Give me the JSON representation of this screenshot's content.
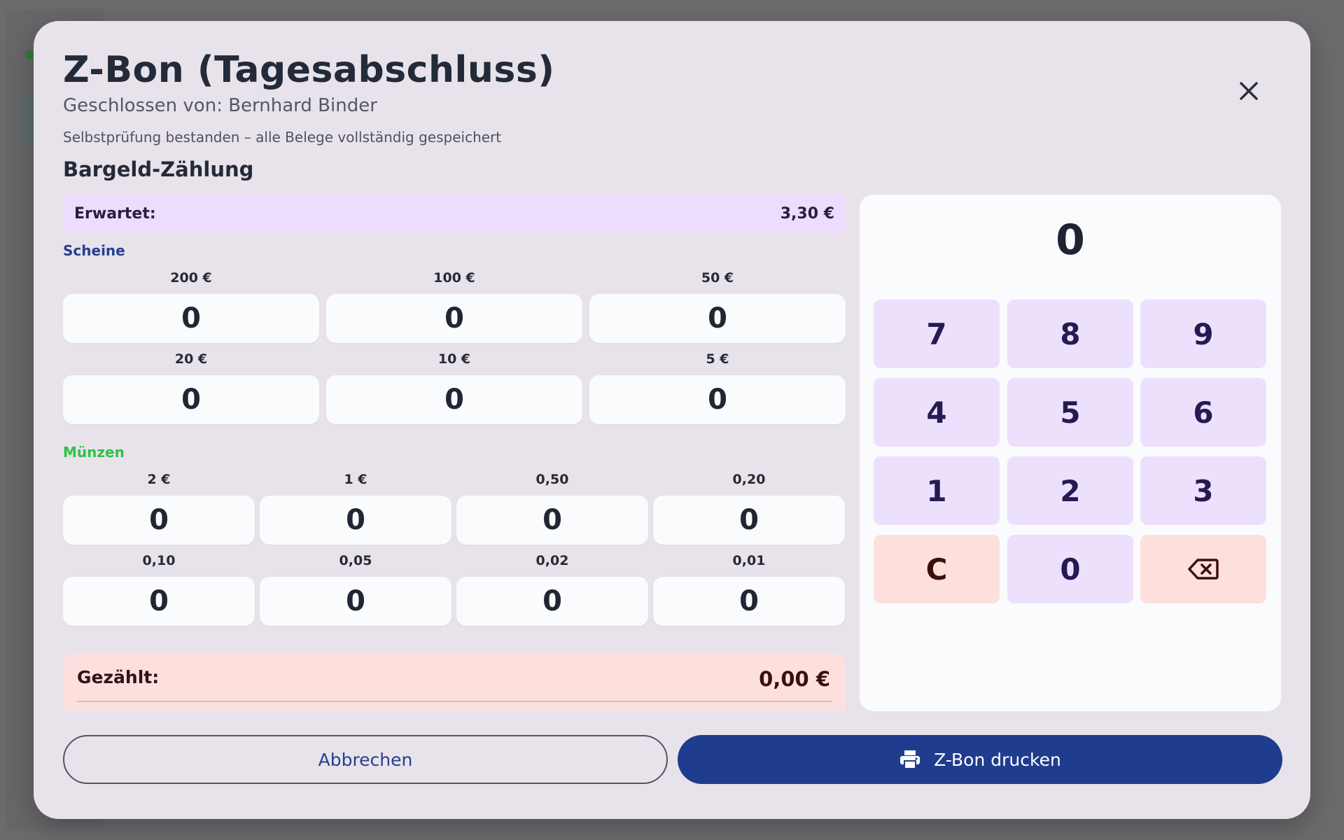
{
  "dialog": {
    "title": "Z-Bon (Tagesabschluss)",
    "closed_by": "Geschlossen von: Bernhard Binder",
    "self_test": "Selbstprüfung bestanden – alle Belege vollständig gespeichert",
    "section_title": "Bargeld-Zählung"
  },
  "expected": {
    "label": "Erwartet:",
    "value": "3,30 €"
  },
  "notes": {
    "label": "Scheine",
    "items": [
      {
        "label": "200 €",
        "value": "0"
      },
      {
        "label": "100 €",
        "value": "0"
      },
      {
        "label": "50 €",
        "value": "0"
      },
      {
        "label": "20 €",
        "value": "0"
      },
      {
        "label": "10 €",
        "value": "0"
      },
      {
        "label": "5 €",
        "value": "0"
      }
    ]
  },
  "coins": {
    "label": "Münzen",
    "items": [
      {
        "label": "2 €",
        "value": "0"
      },
      {
        "label": "1 €",
        "value": "0"
      },
      {
        "label": "0,50",
        "value": "0"
      },
      {
        "label": "0,20",
        "value": "0"
      },
      {
        "label": "0,10",
        "value": "0"
      },
      {
        "label": "0,05",
        "value": "0"
      },
      {
        "label": "0,02",
        "value": "0"
      },
      {
        "label": "0,01",
        "value": "0"
      }
    ]
  },
  "counted": {
    "label": "Gezählt:",
    "value": "0,00 €"
  },
  "keypad": {
    "display": "0",
    "keys": [
      "7",
      "8",
      "9",
      "4",
      "5",
      "6",
      "1",
      "2",
      "3",
      "C",
      "0"
    ],
    "backspace_icon": "backspace-icon"
  },
  "actions": {
    "cancel": "Abbrechen",
    "print": "Z-Bon drucken",
    "print_icon": "printer-icon"
  },
  "colors": {
    "primary": "#1f3c8e",
    "keypad_key": "#ece0fd",
    "danger_key": "#fde0dc",
    "notes_label": "#25408f",
    "coins_label": "#2ec24a"
  }
}
